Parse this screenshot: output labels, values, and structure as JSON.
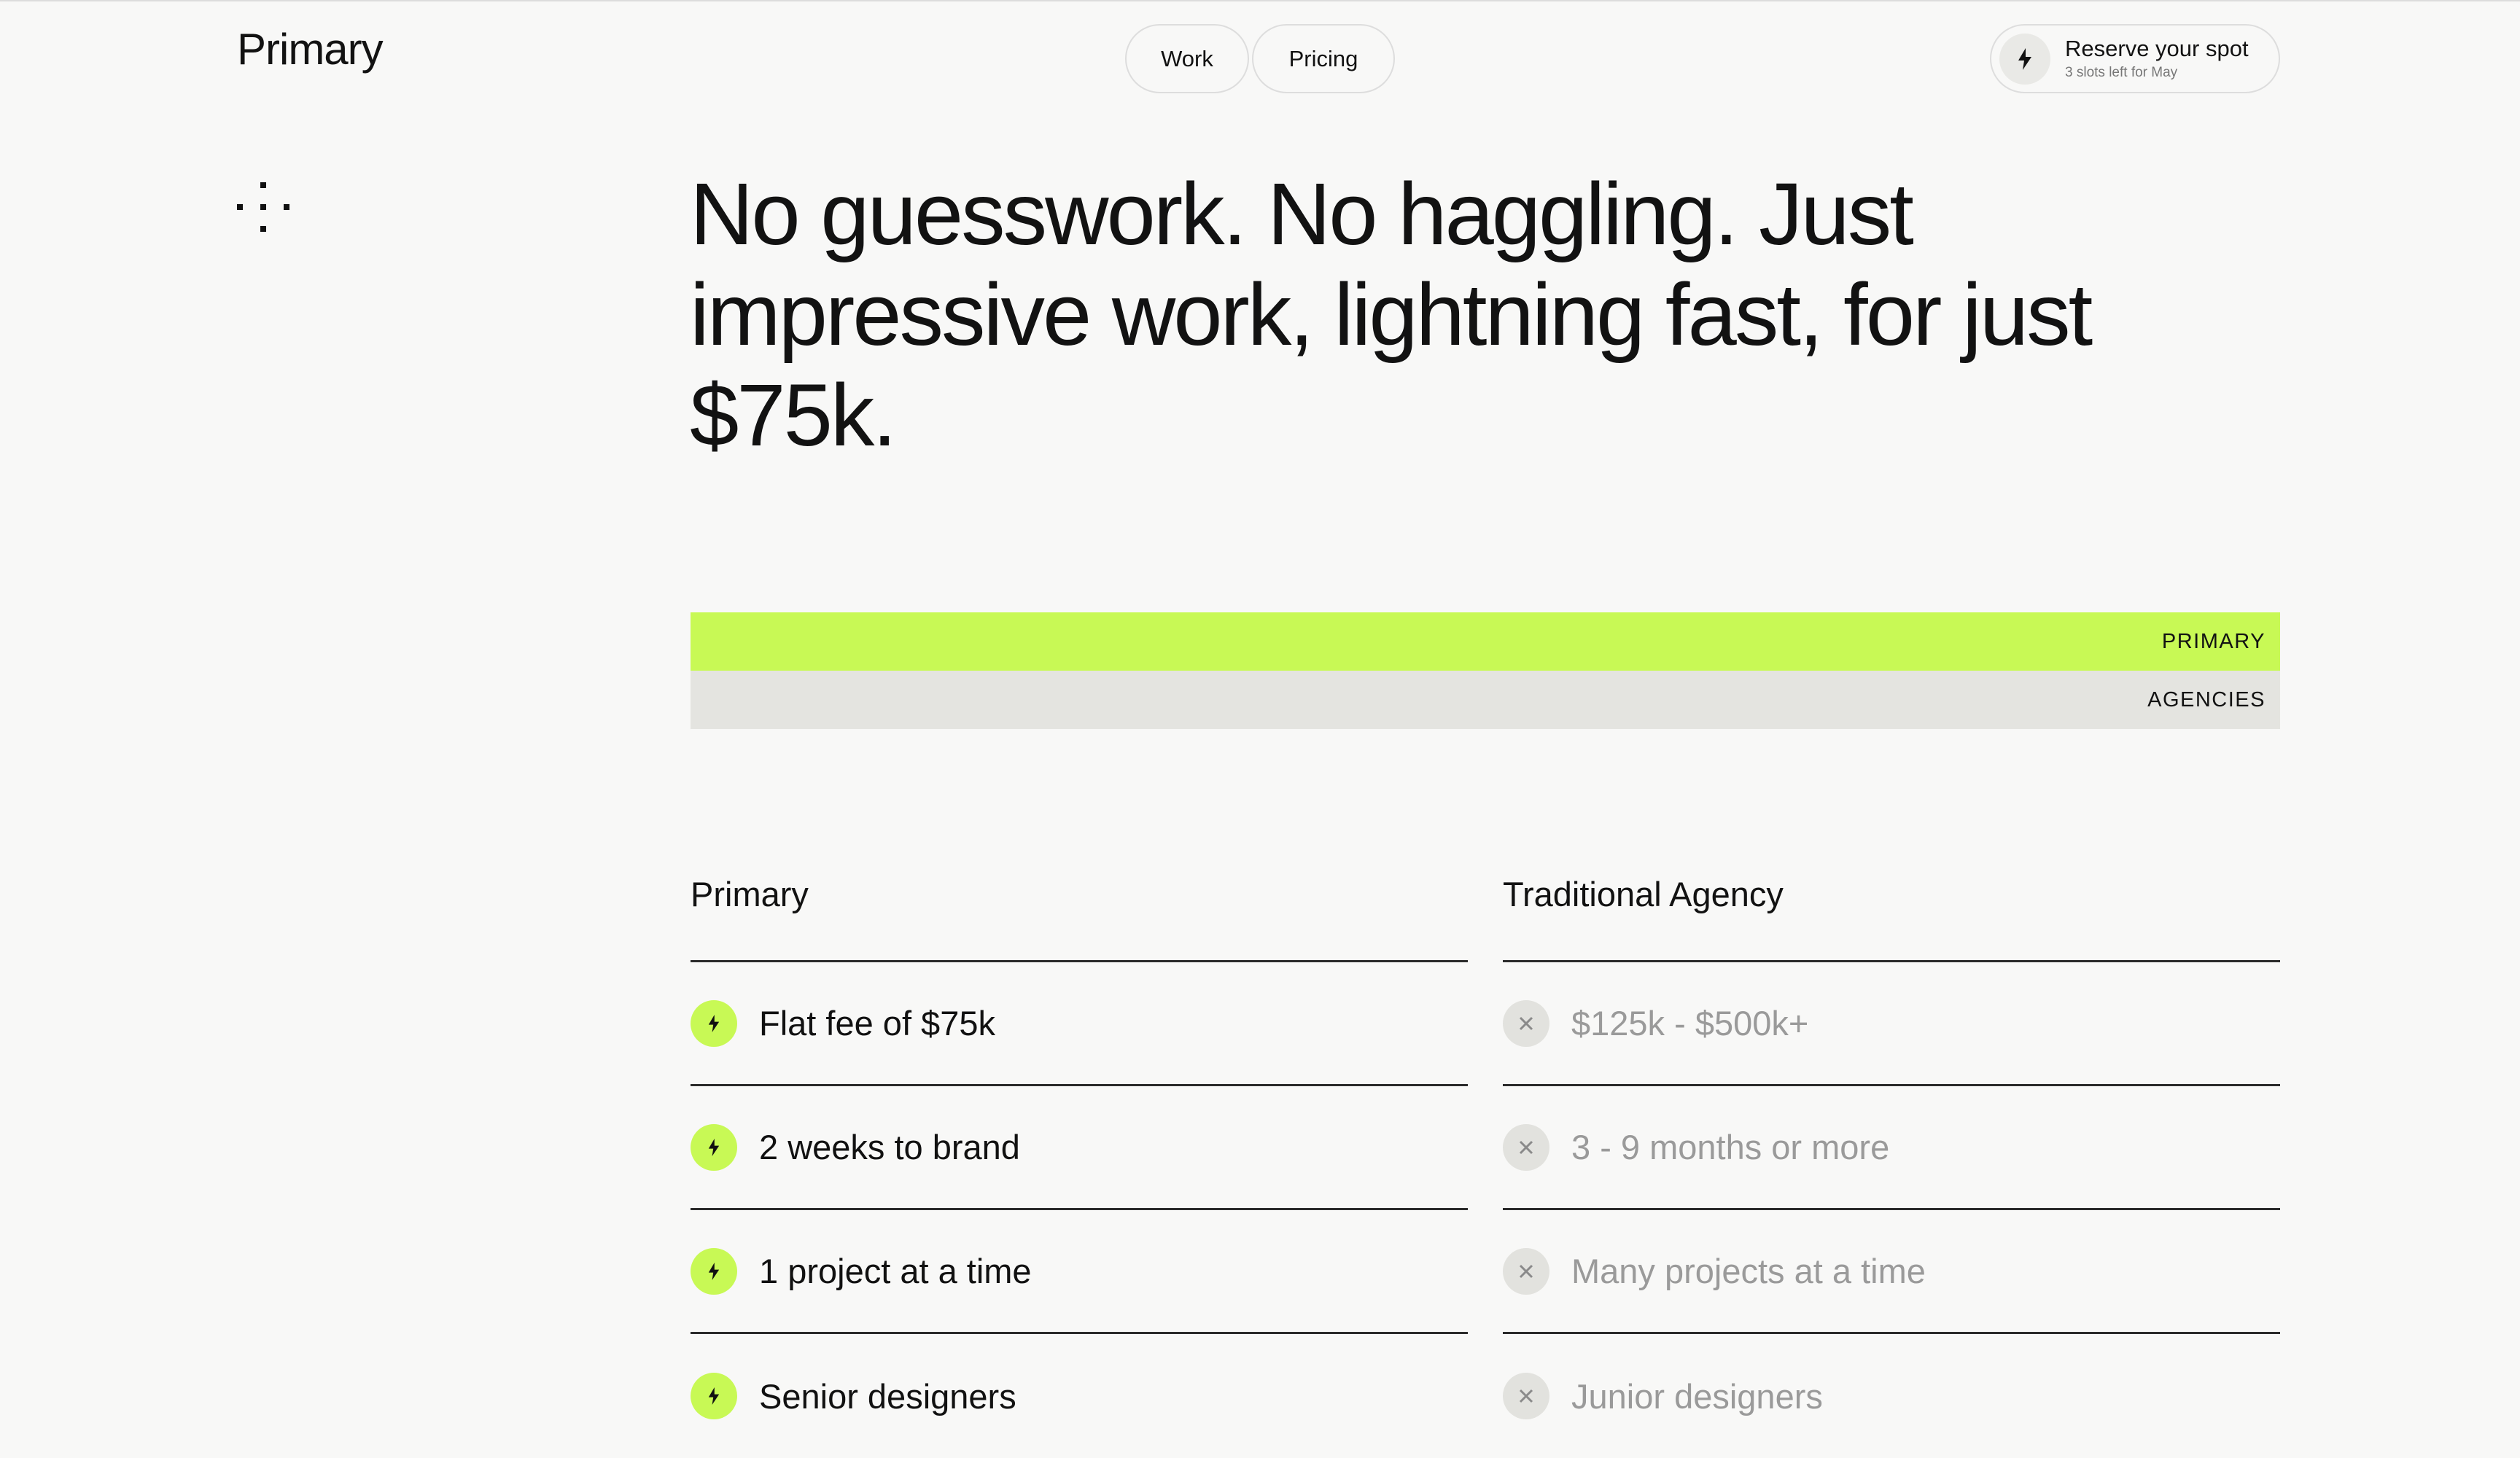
{
  "header": {
    "brand": "Primary",
    "nav": [
      "Work",
      "Pricing"
    ],
    "reserve": {
      "title": "Reserve your spot",
      "subtitle": "3 slots left for May",
      "icon": "bolt-icon"
    }
  },
  "hero": {
    "icon": "dots-icon",
    "headline": "No guesswork. No haggling. Just impressive work, lightning fast, for just $75k."
  },
  "comparison_bars": {
    "primary_label": "PRIMARY",
    "agencies_label": "AGENCIES",
    "primary_color": "#c8f955",
    "agencies_color": "#e4e4e0"
  },
  "comparison": {
    "left_heading": "Primary",
    "right_heading": "Traditional Agency",
    "left_items": [
      "Flat fee of $75k",
      "2 weeks to brand",
      "1 project at a time",
      "Senior designers"
    ],
    "right_items": [
      "$125k - $500k+",
      "3 - 9 months or more",
      "Many projects at a time",
      "Junior designers"
    ]
  }
}
